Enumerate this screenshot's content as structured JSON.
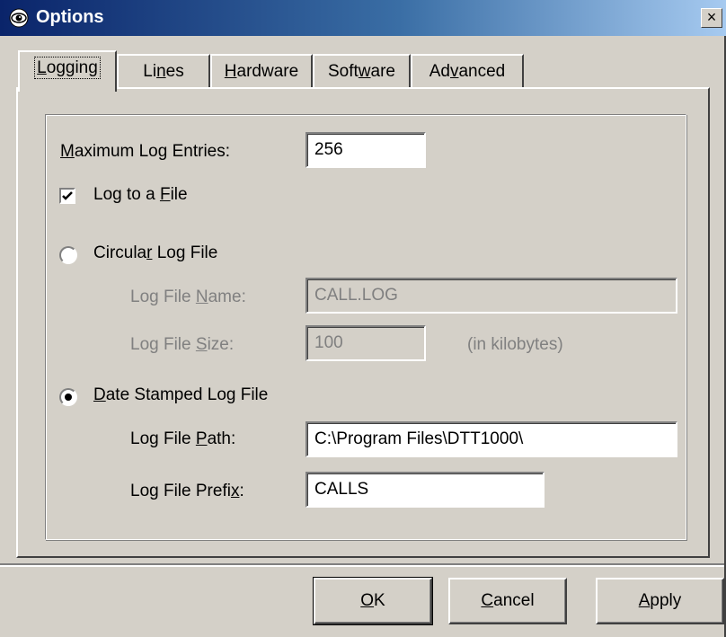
{
  "window": {
    "title": "Options",
    "close_label": "×"
  },
  "tabs": [
    {
      "pre": "",
      "key": "L",
      "post": "ogging",
      "active": true
    },
    {
      "pre": "Li",
      "key": "n",
      "post": "es",
      "active": false
    },
    {
      "pre": "",
      "key": "H",
      "post": "ardware",
      "active": false
    },
    {
      "pre": "Soft",
      "key": "w",
      "post": "are",
      "active": false
    },
    {
      "pre": "Ad",
      "key": "v",
      "post": "anced",
      "active": false
    }
  ],
  "logging": {
    "max_entries": {
      "pre": "",
      "key": "M",
      "post": "aximum Log Entries:",
      "value": "256"
    },
    "log_to_file": {
      "pre": "Log to a ",
      "key": "F",
      "post": "ile",
      "checked": true
    },
    "circular": {
      "pre": "Circula",
      "key": "r",
      "post": " Log File",
      "selected": false,
      "name": {
        "pre": "Log File ",
        "key": "N",
        "post": "ame:",
        "value": "CALL.LOG"
      },
      "size": {
        "pre": "Log File ",
        "key": "S",
        "post": "ize:",
        "value": "100",
        "unit": "(in kilobytes)"
      }
    },
    "date_stamped": {
      "pre": "",
      "key": "D",
      "post": "ate Stamped Log File",
      "selected": true,
      "path": {
        "pre": "Log File ",
        "key": "P",
        "post": "ath:",
        "value": "C:\\Program Files\\DTT1000\\"
      },
      "prefix": {
        "pre": "Log File Prefi",
        "key": "x",
        "post": ":",
        "value": "CALLS"
      }
    }
  },
  "buttons": {
    "ok": {
      "pre": "",
      "key": "O",
      "post": "K"
    },
    "cancel": {
      "pre": "",
      "key": "C",
      "post": "ancel"
    },
    "apply": {
      "pre": "",
      "key": "A",
      "post": "pply"
    }
  }
}
